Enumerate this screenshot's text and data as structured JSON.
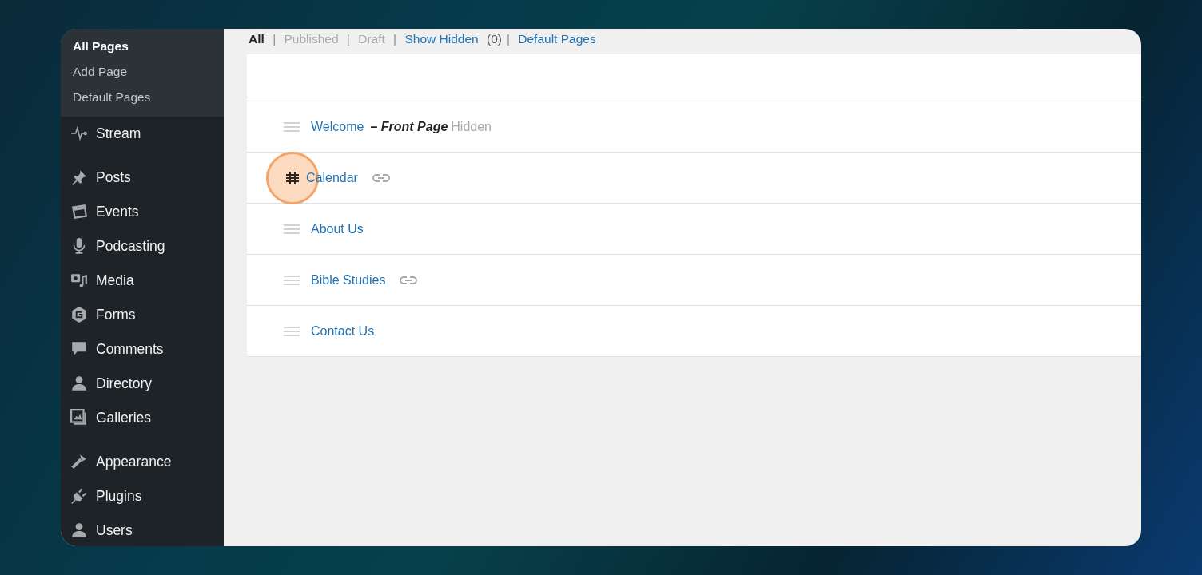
{
  "sidebar": {
    "submenu": [
      {
        "label": "All Pages",
        "selected": true
      },
      {
        "label": "Add Page",
        "selected": false
      },
      {
        "label": "Default Pages",
        "selected": false
      }
    ],
    "items": [
      {
        "label": "Stream",
        "kind": "stream",
        "gap_before": false
      },
      {
        "label": "Posts",
        "kind": "pin",
        "gap_before": true
      },
      {
        "label": "Events",
        "kind": "calendar",
        "gap_before": false
      },
      {
        "label": "Podcasting",
        "kind": "mic",
        "gap_before": false
      },
      {
        "label": "Media",
        "kind": "media",
        "gap_before": false
      },
      {
        "label": "Forms",
        "kind": "forms",
        "gap_before": false
      },
      {
        "label": "Comments",
        "kind": "comment",
        "gap_before": false
      },
      {
        "label": "Directory",
        "kind": "person",
        "gap_before": false
      },
      {
        "label": "Galleries",
        "kind": "gallery",
        "gap_before": false
      },
      {
        "label": "Appearance",
        "kind": "brush",
        "gap_before": true
      },
      {
        "label": "Plugins",
        "kind": "plug",
        "gap_before": false
      },
      {
        "label": "Users",
        "kind": "person",
        "gap_before": false
      }
    ]
  },
  "filters": [
    {
      "label": "All",
      "selected": true,
      "kind": "link"
    },
    {
      "separator": "|",
      "label": "Published",
      "selected": false,
      "kind": "muted"
    },
    {
      "separator": "|",
      "label": "Draft",
      "selected": false,
      "kind": "muted"
    },
    {
      "separator": "|",
      "label": "Show Hidden",
      "selected": false,
      "kind": "link",
      "count": "(0)"
    },
    {
      "separator": "|",
      "label": "Default Pages",
      "selected": false,
      "kind": "link"
    }
  ],
  "pages": [
    {
      "title": "Welcome",
      "suffix": "– Front Page",
      "status": "Hidden",
      "linked": false,
      "grabbed": false
    },
    {
      "title": "Calendar",
      "linked": true,
      "grabbed": true
    },
    {
      "title": "About Us",
      "linked": false,
      "grabbed": false
    },
    {
      "title": "Bible Studies",
      "linked": true,
      "grabbed": false
    },
    {
      "title": "Contact Us",
      "linked": false,
      "grabbed": false
    }
  ]
}
